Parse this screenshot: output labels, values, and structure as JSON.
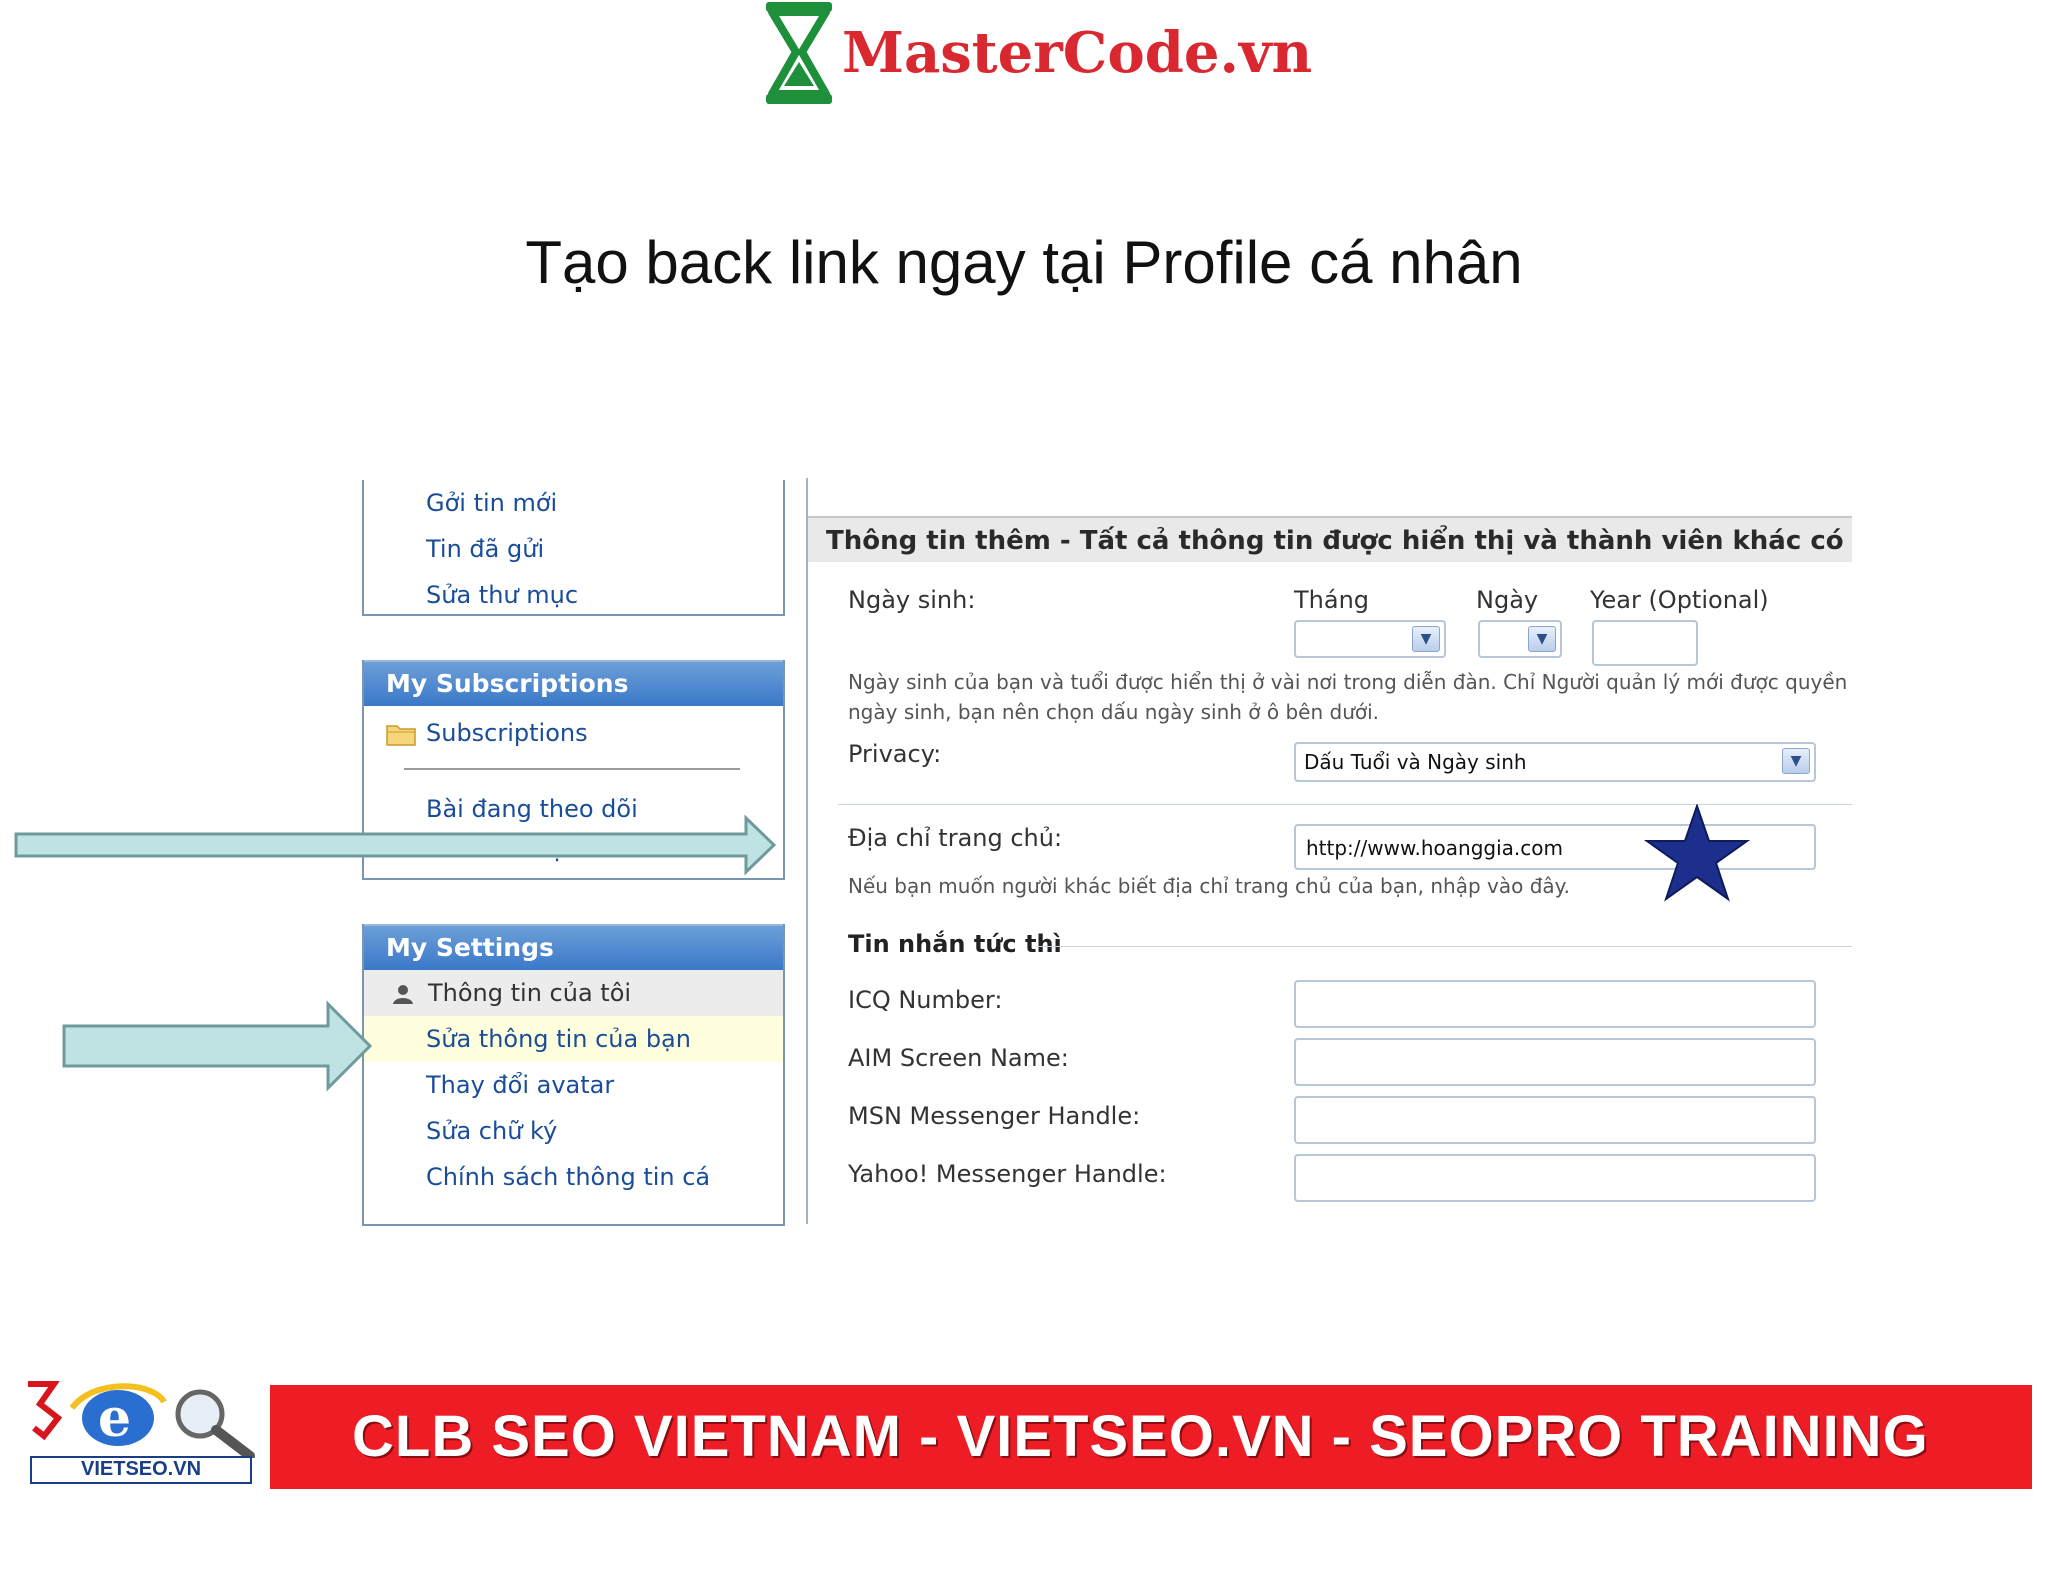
{
  "header": {
    "logo_text": "MasterCode.vn",
    "slide_title": "Tạo back link ngay tại Profile cá nhân"
  },
  "sidebar": {
    "messages_items": [
      "Gởi tin mới",
      "Tin đã gửi",
      "Sửa thư mục"
    ],
    "subscriptions": {
      "title": "My Subscriptions",
      "items": [
        "Subscriptions",
        "Bài đang theo dõi",
        "Sửa thư mục"
      ]
    },
    "settings": {
      "title": "My Settings",
      "items": [
        "Thông tin của tôi",
        "Sửa thông tin của bạn",
        "Thay đổi avatar",
        "Sửa chữ ký",
        "Chính sách thông tin cá"
      ]
    }
  },
  "form": {
    "section_title": "Thông tin thêm - Tất cả thông tin được hiển thị và thành viên khác có thể x",
    "birthday": {
      "label": "Ngày sinh:",
      "month_label": "Tháng",
      "day_label": "Ngày",
      "year_label": "Year (Optional)",
      "help_line1": "Ngày sinh của bạn và tuổi được hiển thị ở vài nơi trong diễn đàn. Chỉ Người quản lý mới được quyền",
      "help_line2": "ngày sinh, bạn nên chọn dấu ngày sinh ở ô bên dưới."
    },
    "privacy": {
      "label": "Privacy:",
      "value": "Dấu Tuổi và Ngày sinh"
    },
    "homepage": {
      "label": "Địa chỉ trang chủ:",
      "value": "http://www.hoanggia.com",
      "help": "Nếu bạn muốn người khác biết địa chỉ trang chủ của bạn, nhập vào đây."
    },
    "im": {
      "title": "Tin nhắn tức thì",
      "fields": [
        "ICQ Number:",
        "AIM Screen Name:",
        "MSN Messenger Handle:",
        "Yahoo! Messenger Handle:"
      ]
    }
  },
  "banner": {
    "text": "CLB SEO VIETNAM - VIETSEO.VN - SEOPRO TRAINING",
    "logo_caption": "VIETSEO.VN"
  },
  "colors": {
    "accent_blue": "#3a78c8",
    "banner_red": "#ee1c24",
    "arrow_fill": "#bfe3e3",
    "star": "#1c2f8c",
    "highlight_row": "#ffffdd"
  }
}
